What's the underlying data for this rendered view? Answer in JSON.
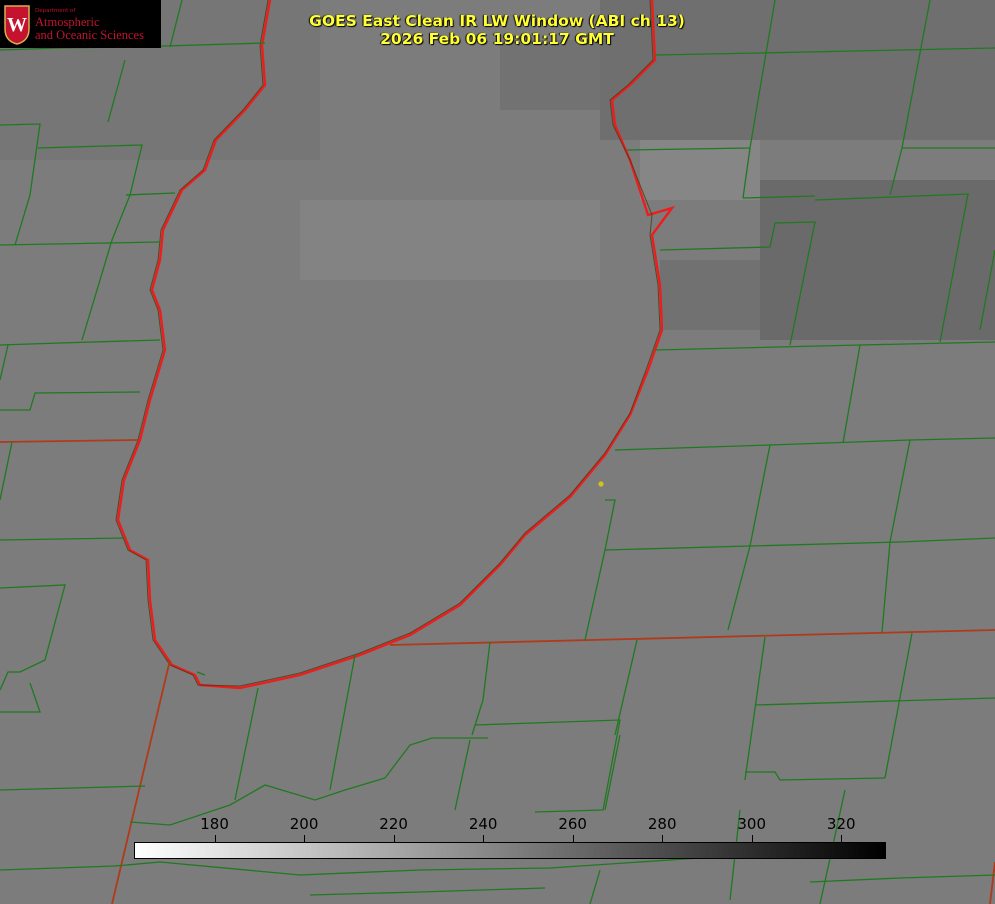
{
  "title": {
    "line1": "GOES East Clean IR LW Window (ABI ch 13)",
    "line2": "2026 Feb 06 19:01:17 GMT"
  },
  "logo": {
    "department": "Department of",
    "line1": "Atmospheric",
    "line2": "and Oceanic Sciences",
    "seal_letter": "W"
  },
  "colorbar": {
    "ticks": [
      "180",
      "200",
      "220",
      "240",
      "260",
      "280",
      "300",
      "320"
    ],
    "range": [
      162,
      330
    ],
    "gradient": [
      "#ffffff",
      "#000000"
    ]
  },
  "colors": {
    "background": "#7d7d7d",
    "county_lines": "#1f7a1f",
    "state_lines": "#b03a1a",
    "coastline": "#ee1c1c",
    "title_text": "#ffff33",
    "marker": "#d4c21c"
  }
}
